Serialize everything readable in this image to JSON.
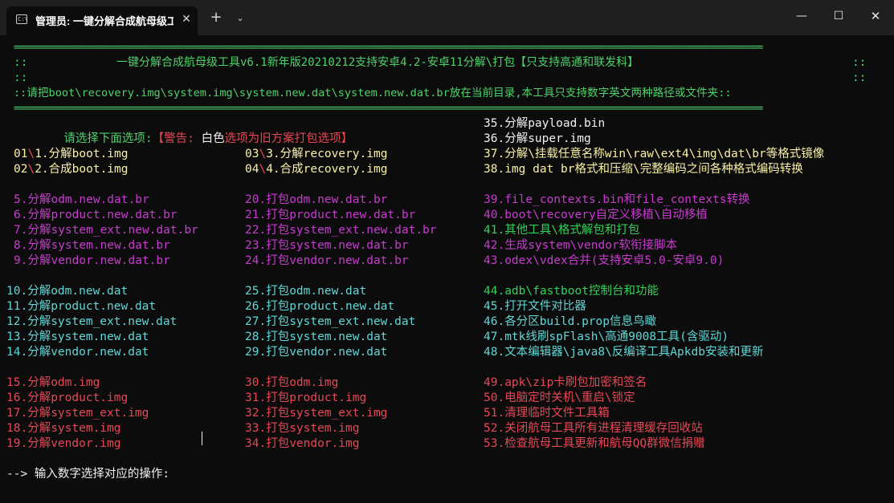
{
  "window": {
    "tab_title": "管理员: 一键分解合成航母级工",
    "tab_icon": "C:\\",
    "close_tab_glyph": "✕",
    "new_tab_glyph": "+",
    "dropdown_glyph": "⌄",
    "minimize_glyph": "—",
    "maximize_glyph": "☐",
    "close_glyph": "✕"
  },
  "colors": {
    "background": "#0c0c0c",
    "titlebar": "#1f1f1f",
    "green": "#4fd26b",
    "red": "#e74856",
    "yellow": "#f9f1a5",
    "magenta": "#c83bd0",
    "cyan": "#61d6d6",
    "white": "#f2f2f2"
  },
  "header": {
    "separator": "=================================================================================================================================================",
    "title_line_left": "::",
    "title_line_text": "一键分解合成航母级工具v6.1新年版20210212支持安卓4.2-安卓11分解\\打包【只支持高通和联发科】",
    "title_line_right": "::",
    "blank_left": "::",
    "blank_right": "::",
    "info_line": "::请把boot\\recovery.img\\system.img\\system.new.dat\\system.new.dat.br放在当前目录,本工具只支持数字英文两种路径或文件夹::"
  },
  "prompt": {
    "choose": "请选择下面选项:",
    "warn_open": "【警告: ",
    "white_word": "白色",
    "warn_rest": "选项为旧方案打包选项】"
  },
  "menu": {
    "o35": "35.分解payload.bin",
    "o36": "36.分解super.img",
    "o01_num": "01",
    "o01_sep": "\\",
    "o01_text": "1.分解boot.img",
    "o03_num": "03",
    "o03_sep": "\\",
    "o03_text": "3.分解recovery.img",
    "o37": "37.分解\\挂载任意名称win\\raw\\ext4\\img\\dat\\br等格式镜像",
    "o02_num": "02",
    "o02_sep": "\\",
    "o02_text": "2.合成boot.img",
    "o04_num": "04",
    "o04_sep": "\\",
    "o04_text": "4.合成recovery.img",
    "o38": "38.img dat br格式和压缩\\完整编码之间各种格式编码转换",
    "o5": "5.分解odm.new.dat.br",
    "o20": "20.打包odm.new.dat.br",
    "o39": "39.file_contexts.bin和file_contexts转换",
    "o6": "6.分解product.new.dat.br",
    "o21": "21.打包product.new.dat.br",
    "o40": "40.boot\\recovery自定义移植\\自动移植",
    "o7": "7.分解system_ext.new.dat.br",
    "o22": "22.打包system_ext.new.dat.br",
    "o41": "41.其他工具\\格式解包和打包",
    "o8": "8.分解system.new.dat.br",
    "o23": "23.打包system.new.dat.br",
    "o42": "42.生成system\\vendor软衔接脚本",
    "o9": "9.分解vendor.new.dat.br",
    "o24": "24.打包vendor.new.dat.br",
    "o43": "43.odex\\vdex合并(支持安卓5.0-安卓9.0)",
    "o10": "10.分解odm.new.dat",
    "o25": "25.打包odm.new.dat",
    "o44": "44.adb\\fastboot控制台和功能",
    "o11": "11.分解product.new.dat",
    "o26": "26.打包product.new.dat",
    "o45": "45.打开文件对比器",
    "o12": "12.分解system_ext.new.dat",
    "o27": "27.打包system_ext.new.dat",
    "o46": "46.各分区build.prop信息鸟瞰",
    "o13": "13.分解system.new.dat",
    "o28": "28.打包system.new.dat",
    "o47": "47.mtk线刷spFlash\\高通9008工具(含驱动)",
    "o14": "14.分解vendor.new.dat",
    "o29": "29.打包vendor.new.dat",
    "o48": "48.文本编辑器\\java8\\反编译工具Apkdb安装和更新",
    "o15": "15.分解odm.img",
    "o30": "30.打包odm.img",
    "o49": "49.apk\\zip卡刷包加密和签名",
    "o16": "16.分解product.img",
    "o31": "31.打包product.img",
    "o50": "50.电脑定时关机\\重启\\锁定",
    "o17": "17.分解system_ext.img",
    "o32": "32.打包system_ext.img",
    "o51": "51.清理临时文件工具箱",
    "o18": "18.分解system.img",
    "o33": "33.打包system.img",
    "o52": "52.关闭航母工具所有进程清理缓存回收站",
    "o19": "19.分解vendor.img",
    "o34": "34.打包vendor.img",
    "o53": "53.检查航母工具更新和航母QQ群微信捐赠"
  },
  "input_prompt": "--> 输入数字选择对应的操作:"
}
